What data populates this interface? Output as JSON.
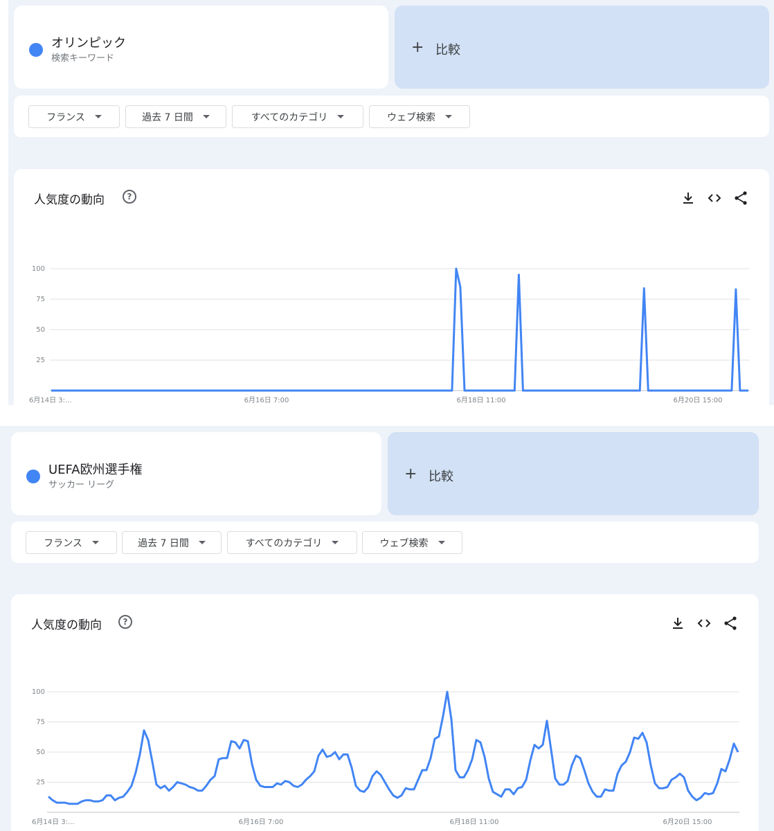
{
  "colors": {
    "accent": "#4285f4",
    "compare_bg": "#d2e1f5",
    "band_bg": "#eef2f9"
  },
  "panels": [
    {
      "term": {
        "title": "オリンピック",
        "subtitle": "検索キーワード"
      },
      "compare": {
        "label": "比較",
        "icon": "plus-icon"
      },
      "filters": [
        {
          "label": "フランス"
        },
        {
          "label": "過去 7 日間"
        },
        {
          "label": "すべてのカテゴリ"
        },
        {
          "label": "ウェブ検索"
        }
      ],
      "chart_title": "人気度の動向",
      "tools": [
        "download-icon",
        "embed-icon",
        "share-icon"
      ]
    },
    {
      "term": {
        "title": "UEFA欧州選手権",
        "subtitle": "サッカー リーグ"
      },
      "compare": {
        "label": "比較",
        "icon": "plus-icon"
      },
      "filters": [
        {
          "label": "フランス"
        },
        {
          "label": "過去 7 日間"
        },
        {
          "label": "すべてのカテゴリ"
        },
        {
          "label": "ウェブ検索"
        }
      ],
      "chart_title": "人気度の動向",
      "tools": [
        "download-icon",
        "embed-icon",
        "share-icon"
      ]
    }
  ],
  "chart_data": [
    {
      "type": "line",
      "x_tick_labels": [
        "6月14日 3:...",
        "6月16日 7:00",
        "6月18日 11:00",
        "6月20日 15:00"
      ],
      "y_ticks": [
        25,
        50,
        75,
        100
      ],
      "ylim": [
        0,
        100
      ],
      "grid": true,
      "series": [
        {
          "color": "#4285f4",
          "x_index_max": 167,
          "points": [
            [
              0,
              0
            ],
            [
              96,
              0
            ],
            [
              97,
              100
            ],
            [
              98,
              85
            ],
            [
              99,
              0
            ],
            [
              111,
              0
            ],
            [
              112,
              95
            ],
            [
              113,
              0
            ],
            [
              141,
              0
            ],
            [
              142,
              84
            ],
            [
              143,
              0
            ],
            [
              163,
              0
            ],
            [
              164,
              83
            ],
            [
              165,
              0
            ],
            [
              167,
              0
            ]
          ]
        }
      ]
    },
    {
      "type": "line",
      "x_tick_labels": [
        "6月14日 3:...",
        "6月16日 7:00",
        "6月18日 11:00",
        "6月20日 15:00"
      ],
      "y_ticks": [
        25,
        50,
        75,
        100
      ],
      "ylim": [
        0,
        100
      ],
      "grid": true,
      "series": [
        {
          "color": "#4285f4",
          "values": [
            13,
            10,
            8,
            8,
            8,
            7,
            7,
            7,
            9,
            10,
            10,
            9,
            9,
            10,
            14,
            14,
            10,
            12,
            13,
            17,
            22,
            33,
            48,
            68,
            60,
            42,
            23,
            20,
            22,
            18,
            21,
            25,
            24,
            23,
            21,
            20,
            18,
            18,
            22,
            27,
            30,
            44,
            45,
            45,
            59,
            58,
            53,
            60,
            59,
            40,
            27,
            22,
            21,
            21,
            21,
            24,
            23,
            26,
            25,
            22,
            21,
            23,
            27,
            30,
            34,
            47,
            52,
            46,
            47,
            50,
            44,
            48,
            48,
            37,
            22,
            18,
            17,
            21,
            30,
            34,
            31,
            25,
            19,
            14,
            12,
            14,
            20,
            19,
            19,
            27,
            35,
            35,
            45,
            61,
            63,
            80,
            100,
            77,
            35,
            29,
            29,
            35,
            44,
            60,
            58,
            46,
            28,
            17,
            15,
            13,
            19,
            19,
            15,
            20,
            21,
            27,
            43,
            56,
            53,
            56,
            76,
            52,
            28,
            23,
            23,
            26,
            39,
            47,
            45,
            35,
            24,
            17,
            13,
            13,
            19,
            18,
            18,
            32,
            39,
            42,
            50,
            62,
            61,
            66,
            58,
            39,
            24,
            20,
            20,
            21,
            27,
            29,
            32,
            29,
            18,
            13,
            10,
            12,
            16,
            15,
            16,
            24,
            36,
            34,
            44,
            57,
            50
          ]
        }
      ]
    }
  ]
}
